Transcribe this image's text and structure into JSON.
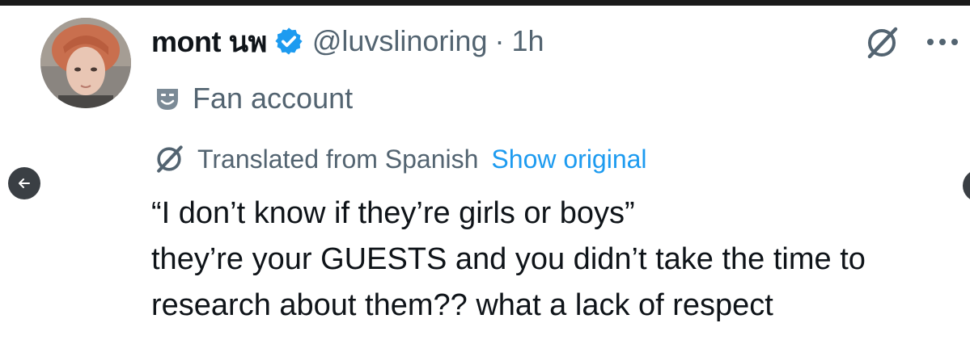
{
  "tweet": {
    "display_name": "mont นพ",
    "handle": "@luvslinoring",
    "separator": "·",
    "time": "1h",
    "label": "Fan account",
    "translation": {
      "notice": "Translated from Spanish",
      "show_original": "Show original"
    },
    "text_lines": [
      "“I don’t know if they’re girls or boys”",
      "they’re your GUESTS and you didn’t take the time to",
      "research about them?? what a lack of respect"
    ]
  },
  "icons": {
    "verified": "verified-badge-icon",
    "label": "theater-mask-icon",
    "grok": "grok-icon",
    "more": "more-icon",
    "translate": "grok-icon",
    "nav_left": "arrow-left-icon"
  },
  "colors": {
    "text_primary": "#0f1419",
    "text_secondary": "#536471",
    "accent": "#1d9bf0"
  }
}
